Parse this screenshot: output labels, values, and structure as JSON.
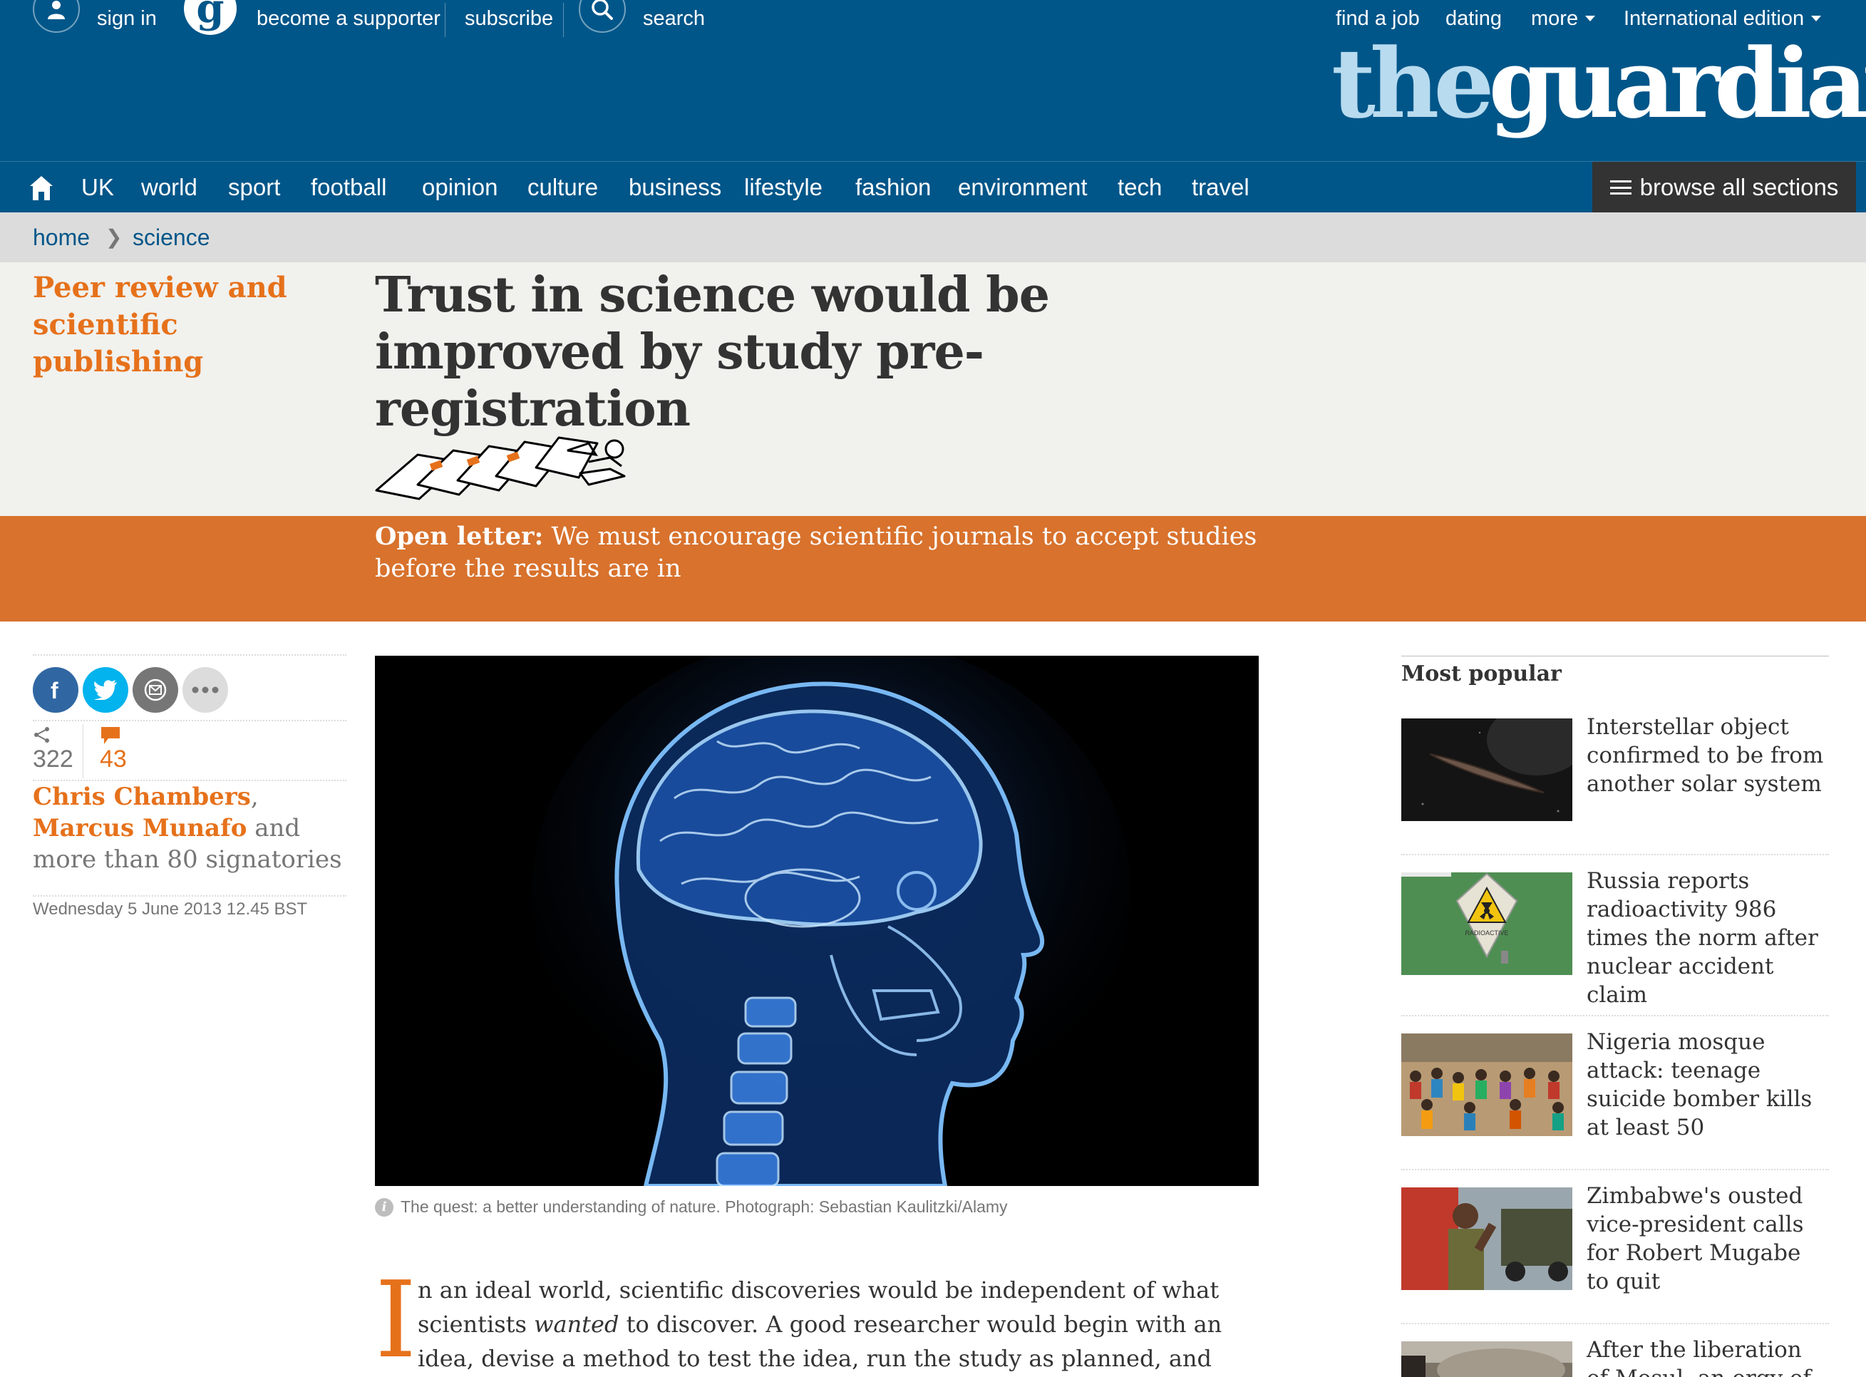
{
  "header": {
    "sign_in": "sign in",
    "become_supporter": "become a supporter",
    "subscribe": "subscribe",
    "search": "search",
    "find_job": "find a job",
    "dating": "dating",
    "more": "more",
    "edition": "International edition",
    "logo_the": "the",
    "logo_guardian": "guardian"
  },
  "nav": {
    "items": [
      "UK",
      "world",
      "sport",
      "football",
      "opinion",
      "culture",
      "business",
      "lifestyle",
      "fashion",
      "environment",
      "tech",
      "travel"
    ],
    "browse": "browse all sections"
  },
  "breadcrumb": {
    "home": "home",
    "separator": "❯",
    "section": "science"
  },
  "article": {
    "series": "Peer review and scientific publishing",
    "headline": "Trust in science would be improved by study pre-registration",
    "standfirst_label": "Open letter:",
    "standfirst_text": " We must encourage scientific journals to accept studies before the results are in",
    "share_count": "322",
    "comment_count": "43",
    "author1": "Chris Chambers",
    "comma": ",",
    "author2": "Marcus Munafo",
    "byline_rest": " and more than 80 signatories",
    "date": "Wednesday 5 June 2013 12.45 BST",
    "caption": "The quest: a better understanding of nature. Photograph: Sebastian Kaulitzki/Alamy",
    "dropcap": "I",
    "body_1": "n an ideal world, scientific discoveries would be independent of what scientists ",
    "body_em": "wanted",
    "body_2": " to discover. A good researcher would begin with an idea, devise a method to test the idea, run the study as planned, and then decide"
  },
  "most_popular": {
    "title": "Most popular",
    "items": [
      {
        "title": "Interstellar object confirmed to be from another solar system"
      },
      {
        "title": "Russia reports radioactivity 986 times the norm after nuclear accident claim",
        "sign_text": "RADIOACTIVE"
      },
      {
        "title": "Nigeria mosque attack: teenage suicide bomber kills at least 50"
      },
      {
        "title": "Zimbabwe's ousted vice-president calls for Robert Mugabe to quit"
      },
      {
        "title": "After the liberation of Mosul, an orgy of killing"
      }
    ]
  },
  "colors": {
    "brand_blue": "#005689",
    "logo_light_blue": "#b8dbef",
    "accent_orange": "#e6711b",
    "standfirst_orange": "#d8722d",
    "headline_bg": "#f1f1ee",
    "facebook": "#3067a3",
    "twitter": "#03b3ee"
  },
  "icons": [
    "person-icon",
    "guardian-g-icon",
    "search-icon",
    "home-icon",
    "hamburger-icon",
    "facebook-icon",
    "twitter-icon",
    "email-icon",
    "more-icon",
    "share-icon",
    "comment-icon",
    "info-icon"
  ]
}
